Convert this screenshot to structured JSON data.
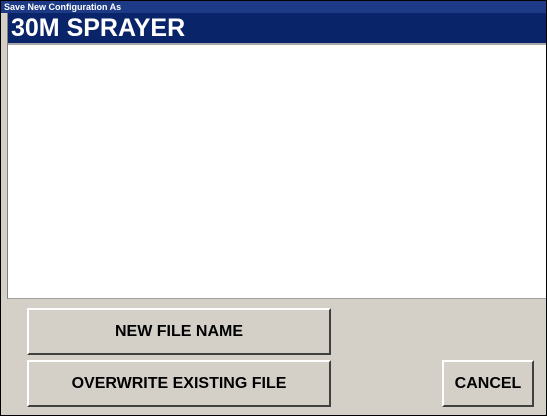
{
  "window": {
    "title": "Save New Configuration As"
  },
  "file_list": {
    "items": [
      {
        "label": "30M SPRAYER",
        "selected": true
      }
    ]
  },
  "buttons": {
    "new_file_name": "NEW FILE NAME",
    "overwrite_existing_file": "OVERWRITE EXISTING FILE",
    "cancel": "CANCEL"
  },
  "colors": {
    "title_bar": "#1c3a85",
    "selection": "#0a246a",
    "face": "#d4d0c8"
  }
}
